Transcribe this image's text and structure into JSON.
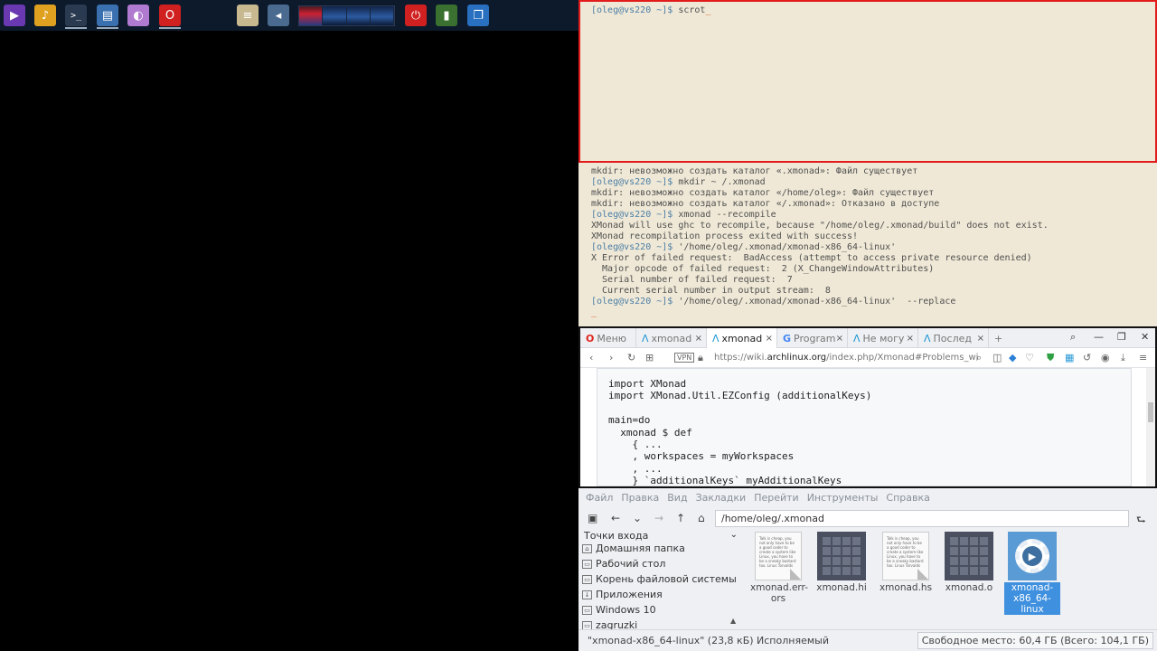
{
  "taskbar": {
    "launchers": [
      {
        "name": "media-player-icon",
        "glyph": "▶",
        "color": "#6a38b0"
      },
      {
        "name": "audio-mixer-icon",
        "glyph": "♪",
        "color": "#e0a020"
      },
      {
        "name": "terminal-icon",
        "glyph": ">_",
        "color": "#2a3a50"
      },
      {
        "name": "file-manager-icon",
        "glyph": "▤",
        "color": "#3a6fb0"
      },
      {
        "name": "graphics-editor-icon",
        "glyph": "◐",
        "color": "#b07ad0"
      },
      {
        "name": "opera-browser-icon",
        "glyph": "O",
        "color": "#d02020"
      },
      {
        "name": "notes-icon",
        "glyph": "≡",
        "color": "#c8b890"
      },
      {
        "name": "volume-icon",
        "glyph": "◂",
        "color": "#4a6a90"
      },
      {
        "name": "power-icon",
        "glyph": "⏻",
        "color": "#d02020"
      },
      {
        "name": "system-monitor-icon",
        "glyph": "▮",
        "color": "#3a7030"
      },
      {
        "name": "windows-list-icon",
        "glyph": "❐",
        "color": "#2a70c0"
      }
    ]
  },
  "terminal_top": {
    "prompt": "[oleg@vs220 ~]$",
    "command": "scrot",
    "cursor": "_"
  },
  "terminal_mid": {
    "lines": [
      {
        "prompt": "",
        "text": "mkdir: невозможно создать каталог «.xmonad»: Файл существует"
      },
      {
        "prompt": "[oleg@vs220 ~]$",
        "text": " mkdir ~ /.xmonad"
      },
      {
        "prompt": "",
        "text": "mkdir: невозможно создать каталог «/home/oleg»: Файл существует"
      },
      {
        "prompt": "",
        "text": "mkdir: невозможно создать каталог «/.xmonad»: Отказано в доступе"
      },
      {
        "prompt": "[oleg@vs220 ~]$",
        "text": " xmonad --recompile"
      },
      {
        "prompt": "",
        "text": "XMonad will use ghc to recompile, because \"/home/oleg/.xmonad/build\" does not exist."
      },
      {
        "prompt": "",
        "text": "XMonad recompilation process exited with success!"
      },
      {
        "prompt": "[oleg@vs220 ~]$",
        "text": " '/home/oleg/.xmonad/xmonad-x86_64-linux'"
      },
      {
        "prompt": "",
        "text": "X Error of failed request:  BadAccess (attempt to access private resource denied)"
      },
      {
        "prompt": "",
        "text": "  Major opcode of failed request:  2 (X_ChangeWindowAttributes)"
      },
      {
        "prompt": "",
        "text": "  Serial number of failed request:  7"
      },
      {
        "prompt": "",
        "text": "  Current serial number in output stream:  8"
      },
      {
        "prompt": "[oleg@vs220 ~]$",
        "text": " '/home/oleg/.xmonad/xmonad-x86_64-linux'  --replace"
      }
    ],
    "cursor": "_"
  },
  "browser": {
    "menu_label": "Меню",
    "tabs": [
      {
        "label": "xmonad",
        "icon": "arch-icon",
        "active": false
      },
      {
        "label": "xmonad",
        "icon": "arch-icon",
        "active": true
      },
      {
        "label": "Program",
        "icon": "google-icon",
        "active": false
      },
      {
        "label": "Не могу",
        "icon": "arch-icon",
        "active": false
      },
      {
        "label": "Послед",
        "icon": "arch-icon",
        "active": false
      }
    ],
    "new_tab": "+",
    "url_prefix": "https://wiki.",
    "url_domain": "archlinux.org",
    "url_rest": "/index.php/Xmonad#Problems_wi",
    "vpn_label": "VPN",
    "code_lines": [
      "import XMonad",
      "import XMonad.Util.EZConfig (additionalKeys)",
      "",
      "main=do",
      "  xmonad $ def",
      "    { ...",
      "    , workspaces = myWorkspaces",
      "    , ...",
      "    } `additionalKeys` myAdditionalKeys"
    ]
  },
  "file_manager": {
    "menu": [
      "Файл",
      "Правка",
      "Вид",
      "Закладки",
      "Перейти",
      "Инструменты",
      "Справка"
    ],
    "path": "/home/oleg/.xmonad",
    "places_header": "Точки входа",
    "places": [
      {
        "label": "Домашняя папка",
        "icon": "home-folder-icon"
      },
      {
        "label": "Рабочий стол",
        "icon": "desktop-icon"
      },
      {
        "label": "Корень файловой системы",
        "icon": "drive-icon"
      },
      {
        "label": "Приложения",
        "icon": "applications-icon"
      },
      {
        "label": "Windows 10",
        "icon": "drive-icon"
      },
      {
        "label": "zagruzki",
        "icon": "folder-icon"
      }
    ],
    "files": [
      {
        "name": "xmonad.err-\nors",
        "kind": "doc",
        "selected": false
      },
      {
        "name": "xmonad.hi",
        "kind": "bin",
        "selected": false
      },
      {
        "name": "xmonad.hs",
        "kind": "doc",
        "selected": false
      },
      {
        "name": "xmonad.o",
        "kind": "bin",
        "selected": false
      },
      {
        "name": "xmonad-\nx86_64-linux",
        "kind": "exe",
        "selected": true
      }
    ],
    "doc_preview": "Talk is cheap, you not only have to be a good coder to create a system like Linux, you have to be a sneaky bastard too. Linus Torvalds",
    "status_left": "\"xmonad-x86_64-linux\" (23,8 кБ) Исполняемый",
    "status_right": "Свободное место: 60,4 ГБ (Всего: 104,1 ГБ)"
  }
}
